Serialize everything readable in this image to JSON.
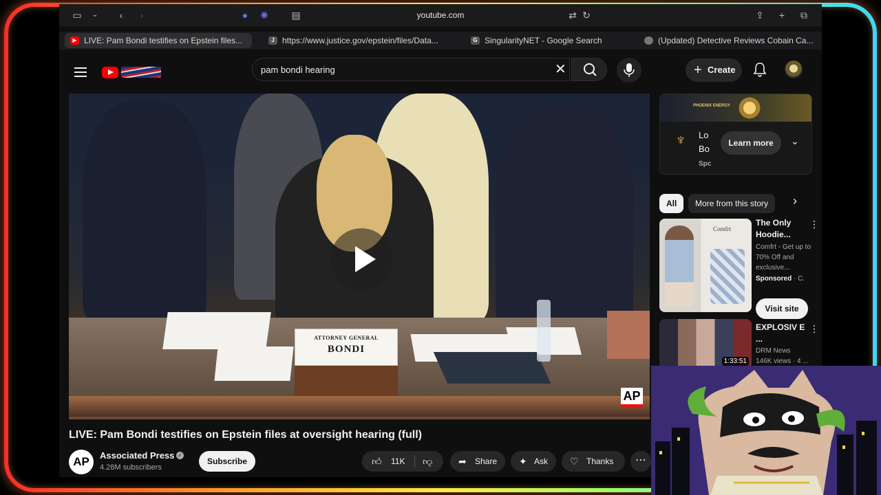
{
  "browser": {
    "url": "youtube.com",
    "tabs": [
      {
        "label": "LIVE: Pam Bondi testifies on Epstein files...",
        "favicon": "youtube-icon",
        "active": true
      },
      {
        "label": "https://www.justice.gov/epstein/files/Data...",
        "favicon_letter": "J"
      },
      {
        "label": "SingularityNET - Google Search",
        "favicon_letter": "G"
      },
      {
        "label": "(Updated) Detective Reviews Cobain Ca...",
        "favicon": "site-icon"
      }
    ]
  },
  "header": {
    "search_value": "pam bondi hearing",
    "create_label": "Create"
  },
  "player": {
    "nameplate_line1": "ATTORNEY GENERAL",
    "nameplate_line2": "BONDI",
    "watermark": "AP"
  },
  "video": {
    "title": "LIVE: Pam Bondi testifies on Epstein files at oversight hearing (full)",
    "channel_logo": "AP",
    "channel_name": "Associated Press",
    "subscribers": "4.28M subscribers",
    "subscribe_label": "Subscribe",
    "likes": "11K",
    "share_label": "Share",
    "ask_label": "Ask",
    "thanks_label": "Thanks"
  },
  "ad": {
    "banner_text": "PHOENIX ENERGY",
    "line1": "Lo",
    "line2": "Bo",
    "sponsor": "Spc",
    "learn_more": "Learn more"
  },
  "chips": [
    "All",
    "More from this story"
  ],
  "recommendations": [
    {
      "title": "The Only Hoodie...",
      "brand": "Comfrt",
      "meta": "Comfrt - Get up to 70% Off and exclusive...",
      "sponsored": "Sponsored",
      "sponsored_suffix": "· C.",
      "cta": "Visit site"
    },
    {
      "title": "EXPLOSIV E ...",
      "channel": "DRM News",
      "views": "146K views · 4 ...",
      "duration": "1:33:51"
    }
  ],
  "colors": {
    "background": "#0f0f0f",
    "youtube_red": "#ff0000",
    "pill_bg": "#272727"
  }
}
